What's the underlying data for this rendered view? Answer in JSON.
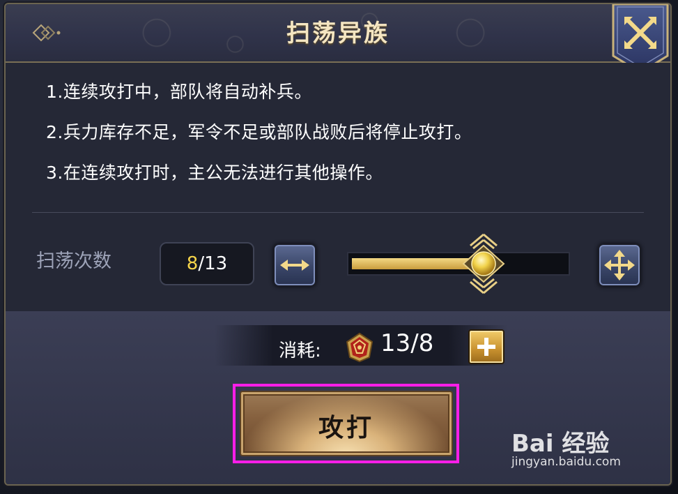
{
  "dialog": {
    "title": "扫荡异族",
    "close_icon": "close-x-icon",
    "back_icon": "diamond-arrow-left-icon"
  },
  "rules": [
    "1.连续攻打中，部队将自动补兵。",
    "2.兵力库存不足，军令不足或部队战败后将停止攻打。",
    "3.在连续攻打时，主公无法进行其他操作。"
  ],
  "sweep": {
    "label": "扫荡次数",
    "current": "8",
    "max_text": "/13",
    "slider_fraction": 0.615,
    "decrease_icon": "min-arrows-icon",
    "increase_icon": "max-arrows-icon"
  },
  "cost": {
    "label": "消耗:",
    "value": "13/8",
    "icon": "military-order-token-icon",
    "add_icon": "plus-icon"
  },
  "attack": {
    "label": "攻打"
  },
  "watermark": {
    "logo": "Bai 经验",
    "url": "jingyan.baidu.com"
  },
  "colors": {
    "accent_gold": "#f3d884",
    "highlight_magenta": "#ff1ee8",
    "count_current": "#f6d54a"
  }
}
